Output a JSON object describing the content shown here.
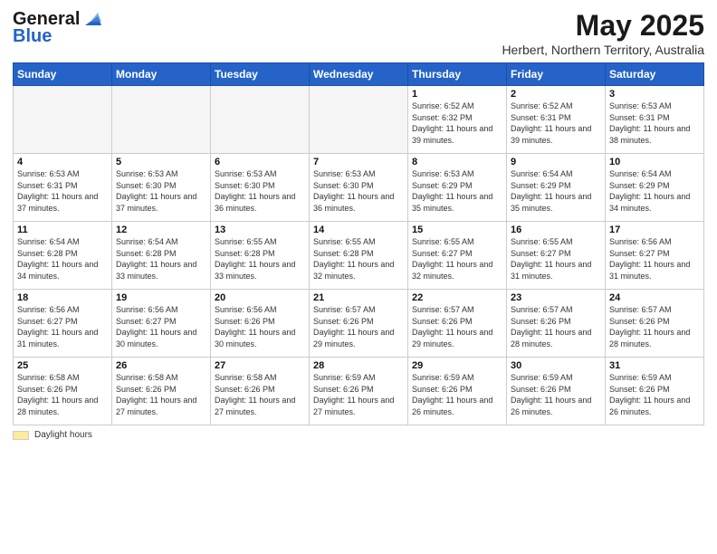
{
  "header": {
    "logo_general": "General",
    "logo_blue": "Blue",
    "main_title": "May 2025",
    "subtitle": "Herbert, Northern Territory, Australia"
  },
  "calendar": {
    "days_of_week": [
      "Sunday",
      "Monday",
      "Tuesday",
      "Wednesday",
      "Thursday",
      "Friday",
      "Saturday"
    ],
    "weeks": [
      [
        {
          "day": "",
          "info": ""
        },
        {
          "day": "",
          "info": ""
        },
        {
          "day": "",
          "info": ""
        },
        {
          "day": "",
          "info": ""
        },
        {
          "day": "1",
          "info": "Sunrise: 6:52 AM\nSunset: 6:32 PM\nDaylight: 11 hours and 39 minutes."
        },
        {
          "day": "2",
          "info": "Sunrise: 6:52 AM\nSunset: 6:31 PM\nDaylight: 11 hours and 39 minutes."
        },
        {
          "day": "3",
          "info": "Sunrise: 6:53 AM\nSunset: 6:31 PM\nDaylight: 11 hours and 38 minutes."
        }
      ],
      [
        {
          "day": "4",
          "info": "Sunrise: 6:53 AM\nSunset: 6:31 PM\nDaylight: 11 hours and 37 minutes."
        },
        {
          "day": "5",
          "info": "Sunrise: 6:53 AM\nSunset: 6:30 PM\nDaylight: 11 hours and 37 minutes."
        },
        {
          "day": "6",
          "info": "Sunrise: 6:53 AM\nSunset: 6:30 PM\nDaylight: 11 hours and 36 minutes."
        },
        {
          "day": "7",
          "info": "Sunrise: 6:53 AM\nSunset: 6:30 PM\nDaylight: 11 hours and 36 minutes."
        },
        {
          "day": "8",
          "info": "Sunrise: 6:53 AM\nSunset: 6:29 PM\nDaylight: 11 hours and 35 minutes."
        },
        {
          "day": "9",
          "info": "Sunrise: 6:54 AM\nSunset: 6:29 PM\nDaylight: 11 hours and 35 minutes."
        },
        {
          "day": "10",
          "info": "Sunrise: 6:54 AM\nSunset: 6:29 PM\nDaylight: 11 hours and 34 minutes."
        }
      ],
      [
        {
          "day": "11",
          "info": "Sunrise: 6:54 AM\nSunset: 6:28 PM\nDaylight: 11 hours and 34 minutes."
        },
        {
          "day": "12",
          "info": "Sunrise: 6:54 AM\nSunset: 6:28 PM\nDaylight: 11 hours and 33 minutes."
        },
        {
          "day": "13",
          "info": "Sunrise: 6:55 AM\nSunset: 6:28 PM\nDaylight: 11 hours and 33 minutes."
        },
        {
          "day": "14",
          "info": "Sunrise: 6:55 AM\nSunset: 6:28 PM\nDaylight: 11 hours and 32 minutes."
        },
        {
          "day": "15",
          "info": "Sunrise: 6:55 AM\nSunset: 6:27 PM\nDaylight: 11 hours and 32 minutes."
        },
        {
          "day": "16",
          "info": "Sunrise: 6:55 AM\nSunset: 6:27 PM\nDaylight: 11 hours and 31 minutes."
        },
        {
          "day": "17",
          "info": "Sunrise: 6:56 AM\nSunset: 6:27 PM\nDaylight: 11 hours and 31 minutes."
        }
      ],
      [
        {
          "day": "18",
          "info": "Sunrise: 6:56 AM\nSunset: 6:27 PM\nDaylight: 11 hours and 31 minutes."
        },
        {
          "day": "19",
          "info": "Sunrise: 6:56 AM\nSunset: 6:27 PM\nDaylight: 11 hours and 30 minutes."
        },
        {
          "day": "20",
          "info": "Sunrise: 6:56 AM\nSunset: 6:26 PM\nDaylight: 11 hours and 30 minutes."
        },
        {
          "day": "21",
          "info": "Sunrise: 6:57 AM\nSunset: 6:26 PM\nDaylight: 11 hours and 29 minutes."
        },
        {
          "day": "22",
          "info": "Sunrise: 6:57 AM\nSunset: 6:26 PM\nDaylight: 11 hours and 29 minutes."
        },
        {
          "day": "23",
          "info": "Sunrise: 6:57 AM\nSunset: 6:26 PM\nDaylight: 11 hours and 28 minutes."
        },
        {
          "day": "24",
          "info": "Sunrise: 6:57 AM\nSunset: 6:26 PM\nDaylight: 11 hours and 28 minutes."
        }
      ],
      [
        {
          "day": "25",
          "info": "Sunrise: 6:58 AM\nSunset: 6:26 PM\nDaylight: 11 hours and 28 minutes."
        },
        {
          "day": "26",
          "info": "Sunrise: 6:58 AM\nSunset: 6:26 PM\nDaylight: 11 hours and 27 minutes."
        },
        {
          "day": "27",
          "info": "Sunrise: 6:58 AM\nSunset: 6:26 PM\nDaylight: 11 hours and 27 minutes."
        },
        {
          "day": "28",
          "info": "Sunrise: 6:59 AM\nSunset: 6:26 PM\nDaylight: 11 hours and 27 minutes."
        },
        {
          "day": "29",
          "info": "Sunrise: 6:59 AM\nSunset: 6:26 PM\nDaylight: 11 hours and 26 minutes."
        },
        {
          "day": "30",
          "info": "Sunrise: 6:59 AM\nSunset: 6:26 PM\nDaylight: 11 hours and 26 minutes."
        },
        {
          "day": "31",
          "info": "Sunrise: 6:59 AM\nSunset: 6:26 PM\nDaylight: 11 hours and 26 minutes."
        }
      ]
    ]
  },
  "legend": {
    "label": "Daylight hours"
  }
}
